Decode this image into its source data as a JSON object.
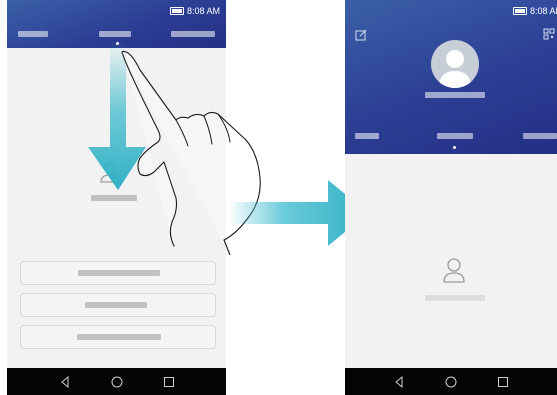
{
  "left_phone": {
    "status_time": "8:08 AM",
    "tabs": [
      "",
      "",
      ""
    ],
    "selected_tab_index": 1,
    "contact_label": "",
    "buttons": [
      "",
      "",
      ""
    ]
  },
  "right_phone": {
    "status_time": "8:08 AM",
    "edit_icon": "edit-icon",
    "qr_icon": "qr-code-icon",
    "profile_name": "",
    "tabs": [
      "",
      "",
      ""
    ],
    "selected_tab_index": 1,
    "contact_label": ""
  },
  "colors": {
    "header_blue": "#2c3f94",
    "arrow_cyan": "#39b9cc",
    "nav_bar": "#050505",
    "screen_bg": "#f2f2f2"
  },
  "icons": {
    "nav_back": "back-triangle-icon",
    "nav_home": "home-circle-icon",
    "nav_recent": "recent-square-icon",
    "person": "person-icon",
    "battery": "battery-icon"
  }
}
